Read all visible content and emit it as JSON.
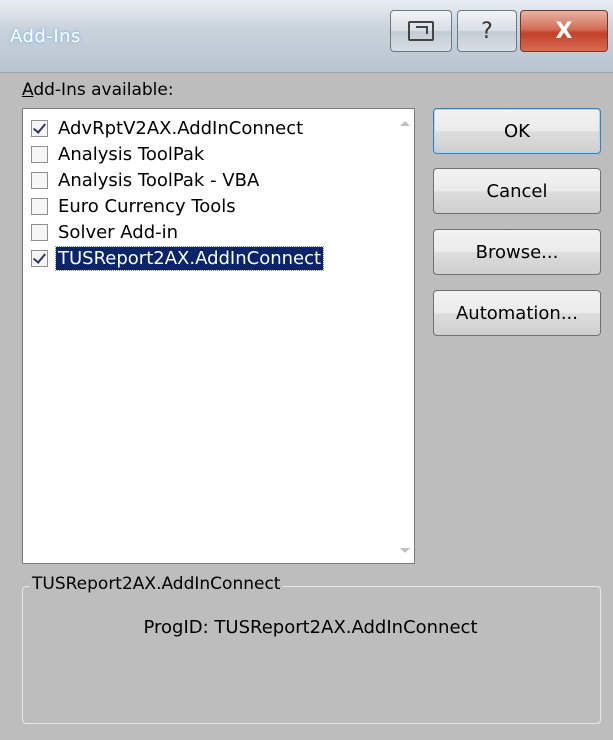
{
  "window": {
    "title": "Add-Ins",
    "help_glyph": "?",
    "close_glyph": "X"
  },
  "list": {
    "label": "Add-Ins available:",
    "items": [
      {
        "label": "AdvRptV2AX.AddInConnect",
        "checked": true,
        "selected": false
      },
      {
        "label": "Analysis ToolPak",
        "checked": false,
        "selected": false
      },
      {
        "label": "Analysis ToolPak - VBA",
        "checked": false,
        "selected": false
      },
      {
        "label": "Euro Currency Tools",
        "checked": false,
        "selected": false
      },
      {
        "label": "Solver Add-in",
        "checked": false,
        "selected": false
      },
      {
        "label": "TUSReport2AX.AddInConnect",
        "checked": true,
        "selected": true
      }
    ]
  },
  "buttons": {
    "ok": "OK",
    "cancel": "Cancel",
    "browse": "Browse...",
    "automation": "Automation..."
  },
  "details": {
    "group_label": "TUSReport2AX.AddInConnect",
    "progid": "ProgID: TUSReport2AX.AddInConnect"
  },
  "icons": {
    "extend": "extend-icon",
    "help": "help-icon",
    "close": "close-icon"
  }
}
